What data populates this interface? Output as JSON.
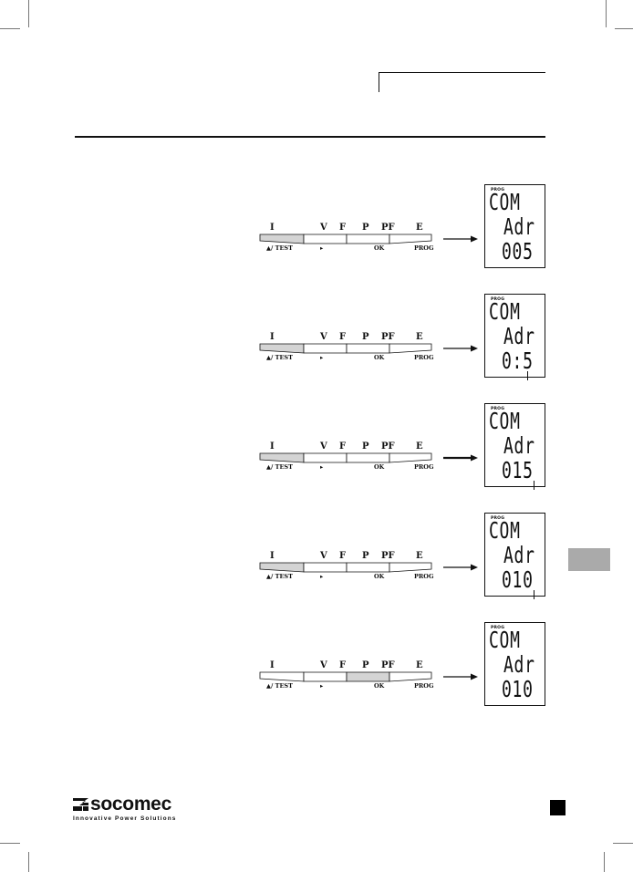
{
  "keypad": {
    "top_labels": [
      "I",
      "V",
      "F",
      "P",
      "PF",
      "E"
    ],
    "bottom_labels": [
      "▲/ TEST",
      "▸",
      "OK",
      "PROG"
    ]
  },
  "steps": [
    {
      "highlighted_key": "up-test",
      "lcd": {
        "mode": "PROG",
        "line1": "COM",
        "line2": "Adr",
        "line3": "005"
      }
    },
    {
      "highlighted_key": "up-test",
      "lcd": {
        "mode": "PROG",
        "line1": "COM",
        "line2": "Adr",
        "line3": "0:5"
      }
    },
    {
      "highlighted_key": "up-test",
      "lcd": {
        "mode": "PROG",
        "line1": "COM",
        "line2": "Adr",
        "line3": "015"
      }
    },
    {
      "highlighted_key": "up-test",
      "lcd": {
        "mode": "PROG",
        "line1": "COM",
        "line2": "Adr",
        "line3": "010"
      }
    },
    {
      "highlighted_key": "ok",
      "lcd": {
        "mode": "PROG",
        "line1": "COM",
        "line2": "Adr",
        "line3": "010"
      }
    }
  ],
  "footer": {
    "brand": "socomec",
    "tagline": "Innovative Power Solutions"
  },
  "colors": {
    "highlight_key": "#d4d4d4",
    "side_tab": "#aaaaaa",
    "ink": "#111111"
  }
}
